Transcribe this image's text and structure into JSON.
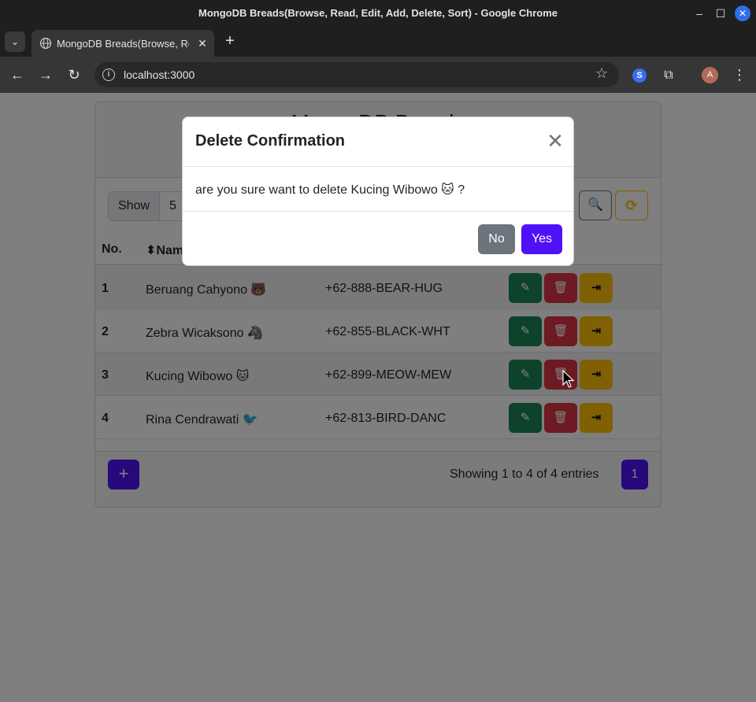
{
  "window": {
    "title": "MongoDB Breads(Browse, Read, Edit, Add, Delete, Sort) - Google Chrome",
    "min_glyph": "–",
    "max_glyph": "☐",
    "close_glyph": "✕"
  },
  "tabs": {
    "list_glyph": "⌄",
    "active_title": "MongoDB Breads(Browse, Read, Edit, Add, Delete, Sort)",
    "close_glyph": "✕",
    "new_tab_glyph": "+"
  },
  "toolbar": {
    "back_glyph": "←",
    "forward_glyph": "→",
    "reload_glyph": "↻",
    "info_glyph": "i",
    "url": "localhost:3000",
    "star_glyph": "☆",
    "ext1_glyph": "S",
    "ext2_glyph": "⧉",
    "avatar_letter": "A",
    "menu_glyph": "⋮"
  },
  "page": {
    "heading": "MongoDB Breads",
    "show_label": "Show",
    "show_value": "5",
    "search_glyph": "🔍",
    "refresh_glyph": "⟳",
    "columns": {
      "no": "No.",
      "name": "⬍Name"
    },
    "rows": [
      {
        "no": "1",
        "name": "Beruang Cahyono 🐻",
        "phone": "+62-888-BEAR-HUG"
      },
      {
        "no": "2",
        "name": "Zebra Wicaksono 🦓",
        "phone": "+62-855-BLACK-WHT"
      },
      {
        "no": "3",
        "name": "Kucing Wibowo 🐱",
        "phone": "+62-899-MEOW-MEW"
      },
      {
        "no": "4",
        "name": "Rina Cendrawati 🐦",
        "phone": "+62-813-BIRD-DANC"
      }
    ],
    "action_glyphs": {
      "edit": "✎",
      "delete": "🗑",
      "open": "⇥"
    },
    "add_glyph": "+",
    "entries_text": "Showing 1 to 4 of 4 entries",
    "current_page": "1"
  },
  "modal": {
    "title": "Delete Confirmation",
    "close_glyph": "✕",
    "body": "are you sure want to delete Kucing Wibowo 🐱 ?",
    "no_label": "No",
    "yes_label": "Yes"
  },
  "colors": {
    "primary": "#4f12f6",
    "success": "#198754",
    "danger": "#dc3545",
    "warning": "#ffc107",
    "secondary": "#6c757d"
  }
}
